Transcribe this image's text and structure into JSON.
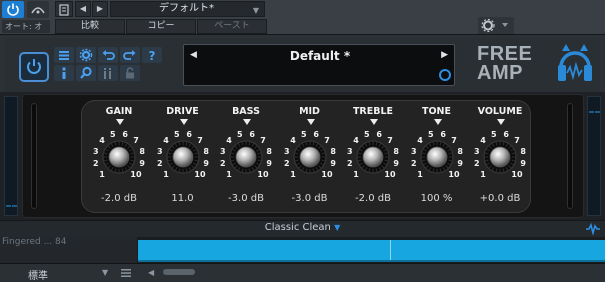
{
  "host": {
    "auto_label": "オート: オフ",
    "preset_name": "デフォルト*",
    "compare_label": "比較",
    "copy_label": "コピー",
    "paste_label": "ペースト"
  },
  "plugin": {
    "preset": "Default *",
    "logo_line1": "FREE",
    "logo_line2": "AMP",
    "mode": "Classic Clean",
    "knobs": [
      {
        "label": "GAIN",
        "value": "-2.0 dB",
        "scale": [
          1,
          2,
          3,
          4,
          5,
          6,
          7,
          8,
          9,
          10
        ]
      },
      {
        "label": "DRIVE",
        "value": "11.0",
        "scale": [
          1,
          2,
          3,
          4,
          5,
          6,
          7,
          8,
          9,
          10
        ]
      },
      {
        "label": "BASS",
        "value": "-3.0 dB",
        "scale": [
          1,
          2,
          3,
          4,
          5,
          6,
          7,
          8,
          9,
          10
        ]
      },
      {
        "label": "MID",
        "value": "-3.0 dB",
        "scale": [
          1,
          2,
          3,
          4,
          5,
          6,
          7,
          8,
          9,
          10
        ]
      },
      {
        "label": "TREBLE",
        "value": "-2.0 dB",
        "scale": [
          1,
          2,
          3,
          4,
          5,
          6,
          7,
          8,
          9,
          10
        ]
      },
      {
        "label": "TONE",
        "value": "100 %",
        "scale": [
          1,
          2,
          3,
          4,
          5,
          6,
          7,
          8,
          9,
          10
        ]
      },
      {
        "label": "VOLUME",
        "value": "+0.0 dB",
        "scale": [
          1,
          2,
          3,
          4,
          5,
          6,
          7,
          8,
          9,
          10
        ]
      }
    ]
  },
  "track": {
    "name": "Fingered ...  84"
  },
  "bottom": {
    "standard_label": "標準"
  },
  "colors": {
    "accent": "#1d7fd4",
    "clip": "#18a6e0"
  }
}
